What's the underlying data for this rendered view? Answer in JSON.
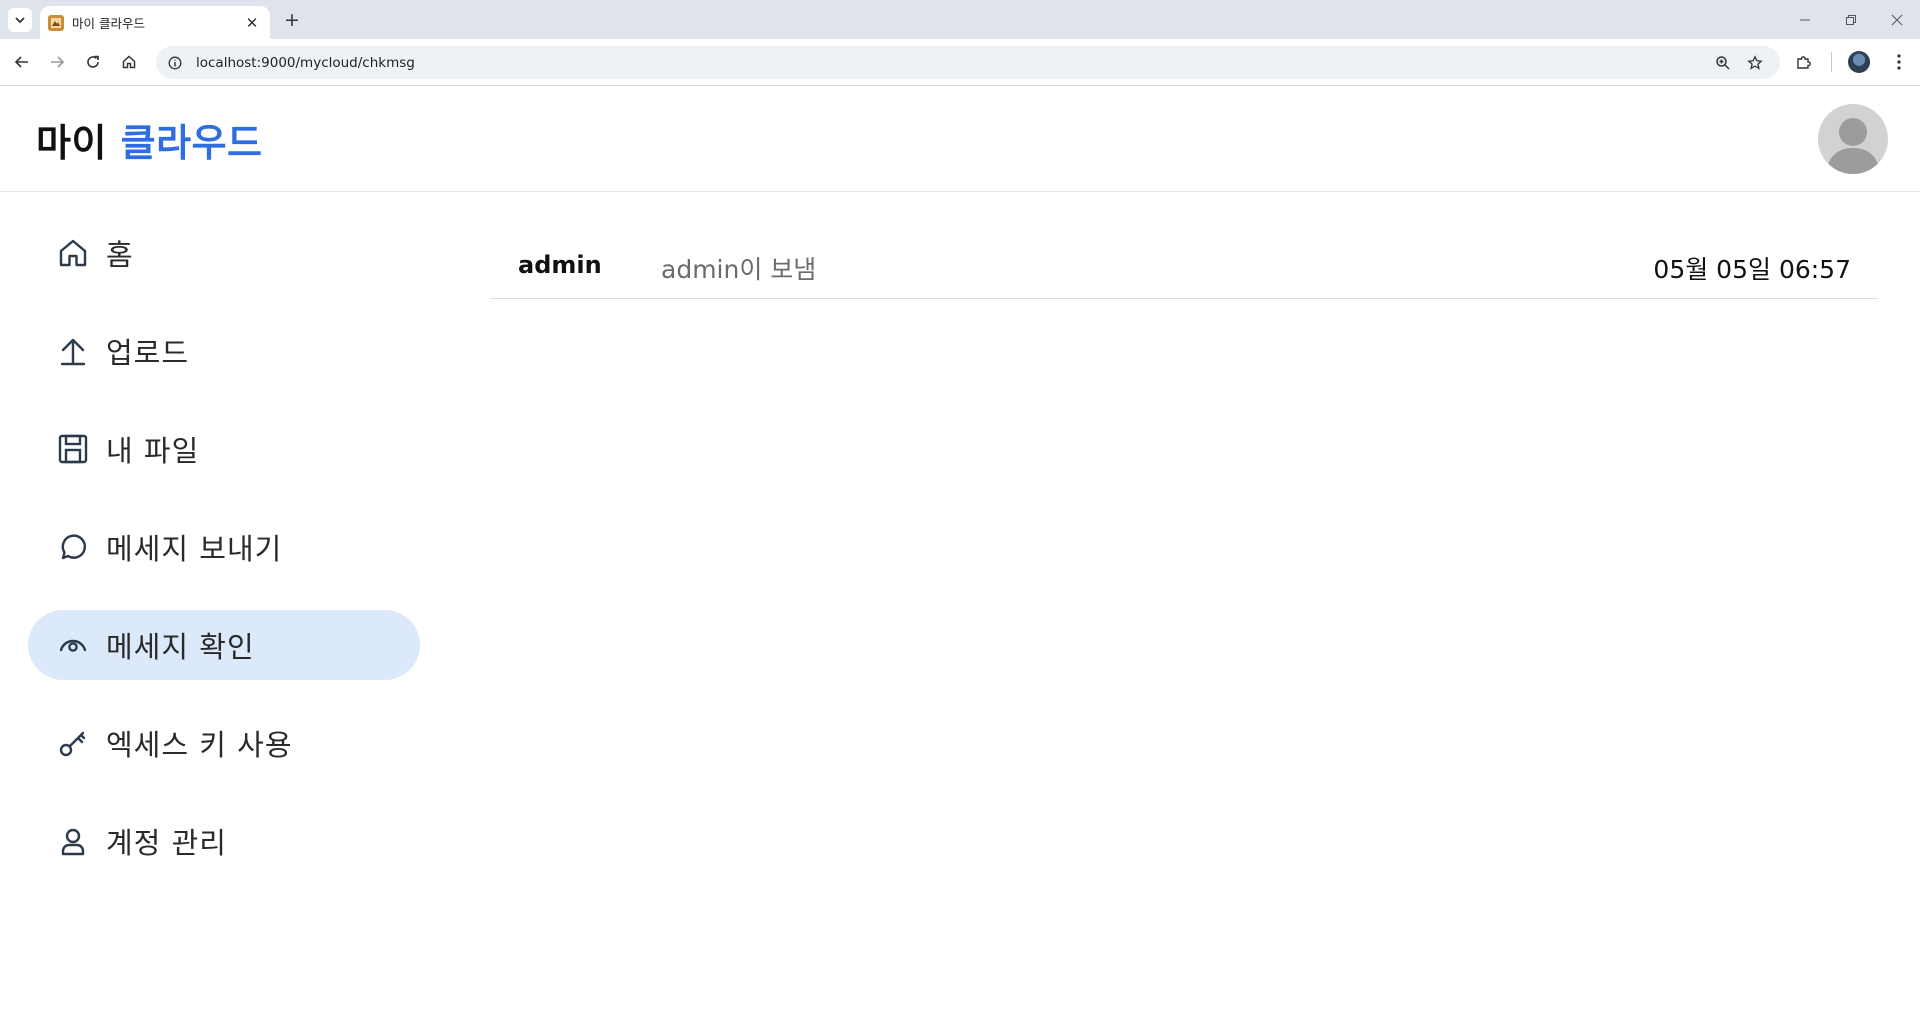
{
  "browser": {
    "tab_title": "마이 클라우드",
    "new_tab_label": "+",
    "url": "localhost:9000/mycloud/chkmsg"
  },
  "header": {
    "brand_part1": "마이",
    "brand_part2": "클라우드"
  },
  "sidebar": {
    "items": [
      {
        "label": "홈",
        "icon": "home-icon",
        "active": false
      },
      {
        "label": "업로드",
        "icon": "upload-icon",
        "active": false
      },
      {
        "label": "내 파일",
        "icon": "save-icon",
        "active": false
      },
      {
        "label": "메세지 보내기",
        "icon": "chat-bubble-icon",
        "active": false
      },
      {
        "label": "메세지 확인",
        "icon": "eye-icon",
        "active": true
      },
      {
        "label": "엑세스 키 사용",
        "icon": "key-icon",
        "active": false
      },
      {
        "label": "계정 관리",
        "icon": "user-icon",
        "active": false
      }
    ]
  },
  "messages": [
    {
      "sender": "admin",
      "text": "admin이 보냄",
      "time": "05월 05일 06:57"
    }
  ],
  "colors": {
    "accent": "#2f6ee0",
    "active_bg": "#dce9fb"
  }
}
